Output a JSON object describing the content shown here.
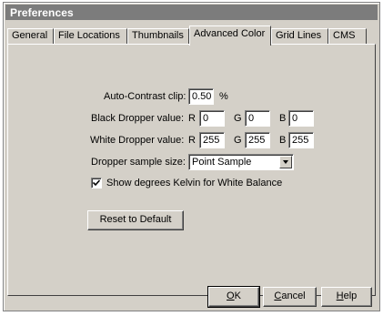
{
  "window": {
    "title": "Preferences"
  },
  "tabs": [
    "General",
    "File Locations",
    "Thumbnails",
    "Advanced Color",
    "Grid Lines",
    "CMS"
  ],
  "active_tab": "Advanced Color",
  "auto_contrast": {
    "label": "Auto-Contrast clip:",
    "value": "0.50",
    "unit": "%"
  },
  "black_dropper": {
    "label": "Black Dropper value:",
    "r_label": "R",
    "r": "0",
    "g_label": "G",
    "g": "0",
    "b_label": "B",
    "b": "0"
  },
  "white_dropper": {
    "label": "White Dropper value:",
    "r_label": "R",
    "r": "255",
    "g_label": "G",
    "g": "255",
    "b_label": "B",
    "b": "255"
  },
  "sample_size": {
    "label": "Dropper sample size:",
    "value": "Point Sample"
  },
  "kelvin_checkbox": {
    "label": "Show degrees Kelvin for White Balance",
    "checked": true
  },
  "buttons": {
    "reset": "Reset to Default",
    "ok_pre": "",
    "ok_ul": "O",
    "ok_post": "K",
    "cancel_pre": "",
    "cancel_ul": "C",
    "cancel_post": "ancel",
    "help_pre": "",
    "help_ul": "H",
    "help_post": "elp"
  },
  "colors": {
    "title_bar": "#7c7c7c",
    "face": "#d4d0c8"
  }
}
